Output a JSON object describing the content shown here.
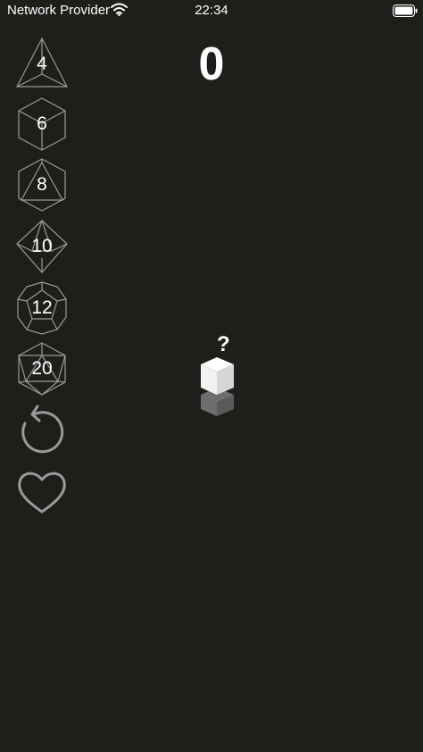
{
  "status_bar": {
    "carrier": "Network Provider",
    "time": "22:34",
    "wifi_icon": "wifi-icon",
    "battery_icon": "battery-icon"
  },
  "score": "0",
  "dice": [
    {
      "label": "4",
      "icon": "d4-icon"
    },
    {
      "label": "6",
      "icon": "d6-icon"
    },
    {
      "label": "8",
      "icon": "d8-icon"
    },
    {
      "label": "10",
      "icon": "d10-icon"
    },
    {
      "label": "12",
      "icon": "d12-icon"
    },
    {
      "label": "20",
      "icon": "d20-icon"
    }
  ],
  "actions": {
    "reset_icon": "reset-icon",
    "favorite_icon": "heart-icon"
  },
  "result": {
    "pending_symbol": "?"
  },
  "colors": {
    "background": "#1f1e1b",
    "text": "#ffffff",
    "icon_stroke": "#9a9a9a",
    "cube_top": "#ffffff",
    "cube_side": "#dcdcdc",
    "cube_shadow": "#6e6e6e"
  }
}
